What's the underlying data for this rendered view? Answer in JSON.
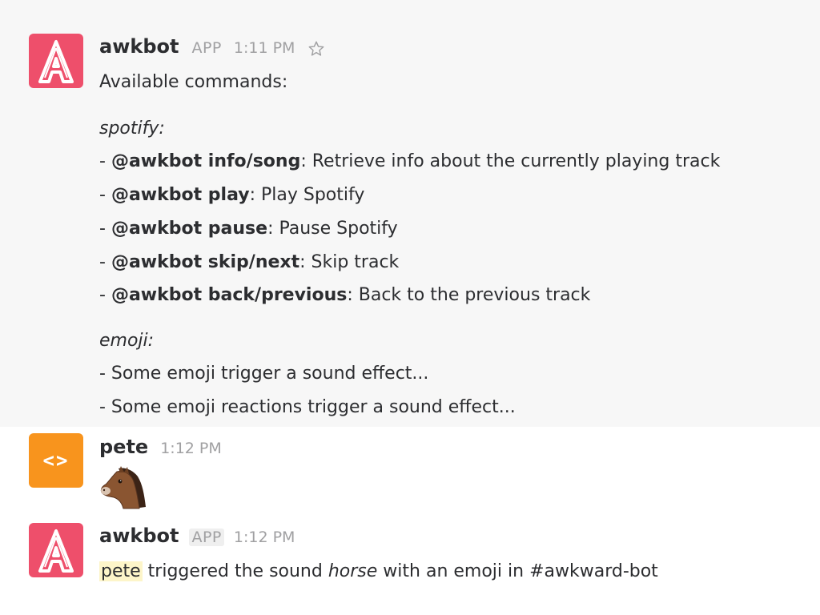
{
  "messages": {
    "m1": {
      "author": "awkbot",
      "badge": "APP",
      "time": "1:11 PM",
      "intro": "Available commands:",
      "section_spotify": "spotify:",
      "spotify_cmds": [
        {
          "dash": "- ",
          "cmd": "@awkbot info/song",
          "desc": ": Retrieve info about the currently playing track"
        },
        {
          "dash": "- ",
          "cmd": "@awkbot play",
          "desc": ": Play Spotify"
        },
        {
          "dash": "- ",
          "cmd": "@awkbot pause",
          "desc": ": Pause Spotify"
        },
        {
          "dash": "- ",
          "cmd": "@awkbot skip/next",
          "desc": ": Skip track"
        },
        {
          "dash": "- ",
          "cmd": "@awkbot back/previous",
          "desc": ": Back to the previous track"
        }
      ],
      "section_emoji": "emoji:",
      "emoji_lines": [
        "- Some emoji trigger a sound effect...",
        "- Some emoji reactions trigger a sound effect..."
      ]
    },
    "m2": {
      "author": "pete",
      "time": "1:12 PM",
      "avatar_text": "<>",
      "emoji": "horse-emoji"
    },
    "m3": {
      "author": "awkbot",
      "badge": "APP",
      "time": "1:12 PM",
      "mention": "pete",
      "text_before": " triggered the sound ",
      "sound_name": "horse",
      "text_after": " with an emoji in #awkward-bot"
    }
  },
  "colors": {
    "awkbot_avatar": "#ee4f6b",
    "pete_avatar": "#f8941d",
    "highlight_bg": "#f7f7f7",
    "mention_bg": "#fdf5c9"
  },
  "icons": {
    "awkbot_avatar": "letter-a-logo-icon",
    "star": "star-outline-icon"
  }
}
